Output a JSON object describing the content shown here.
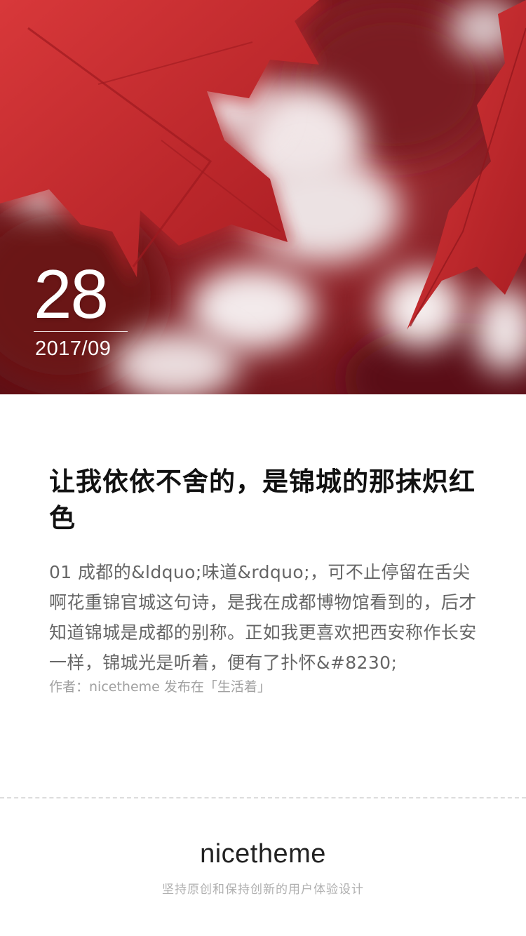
{
  "hero": {
    "image": "red-maple-leaves-photo",
    "day": "28",
    "year_month": "2017/09"
  },
  "article": {
    "title": "让我依依不舍的，是锦城的那抹炽红色",
    "excerpt": "01 成都的&ldquo;味道&rdquo;，可不止停留在舌尖啊花重锦官城这句诗，是我在成都博物馆看到的，后才知道锦城是成都的别称。正如我更喜欢把西安称作长安一样，锦城光是听着，便有了扑怀&#8230;",
    "meta_prefix": "作者：",
    "author": "nicetheme",
    "meta_mid": " 发布在",
    "category": "「生活着」"
  },
  "footer": {
    "brand": "nicetheme",
    "slogan": "坚持原创和保持创新的用户体验设计"
  },
  "colors": {
    "hero_red": "#8a1f25",
    "leaf_red": "#c42a2e",
    "title": "#111111",
    "body_text": "#666666",
    "meta_text": "#a0a0a0"
  }
}
